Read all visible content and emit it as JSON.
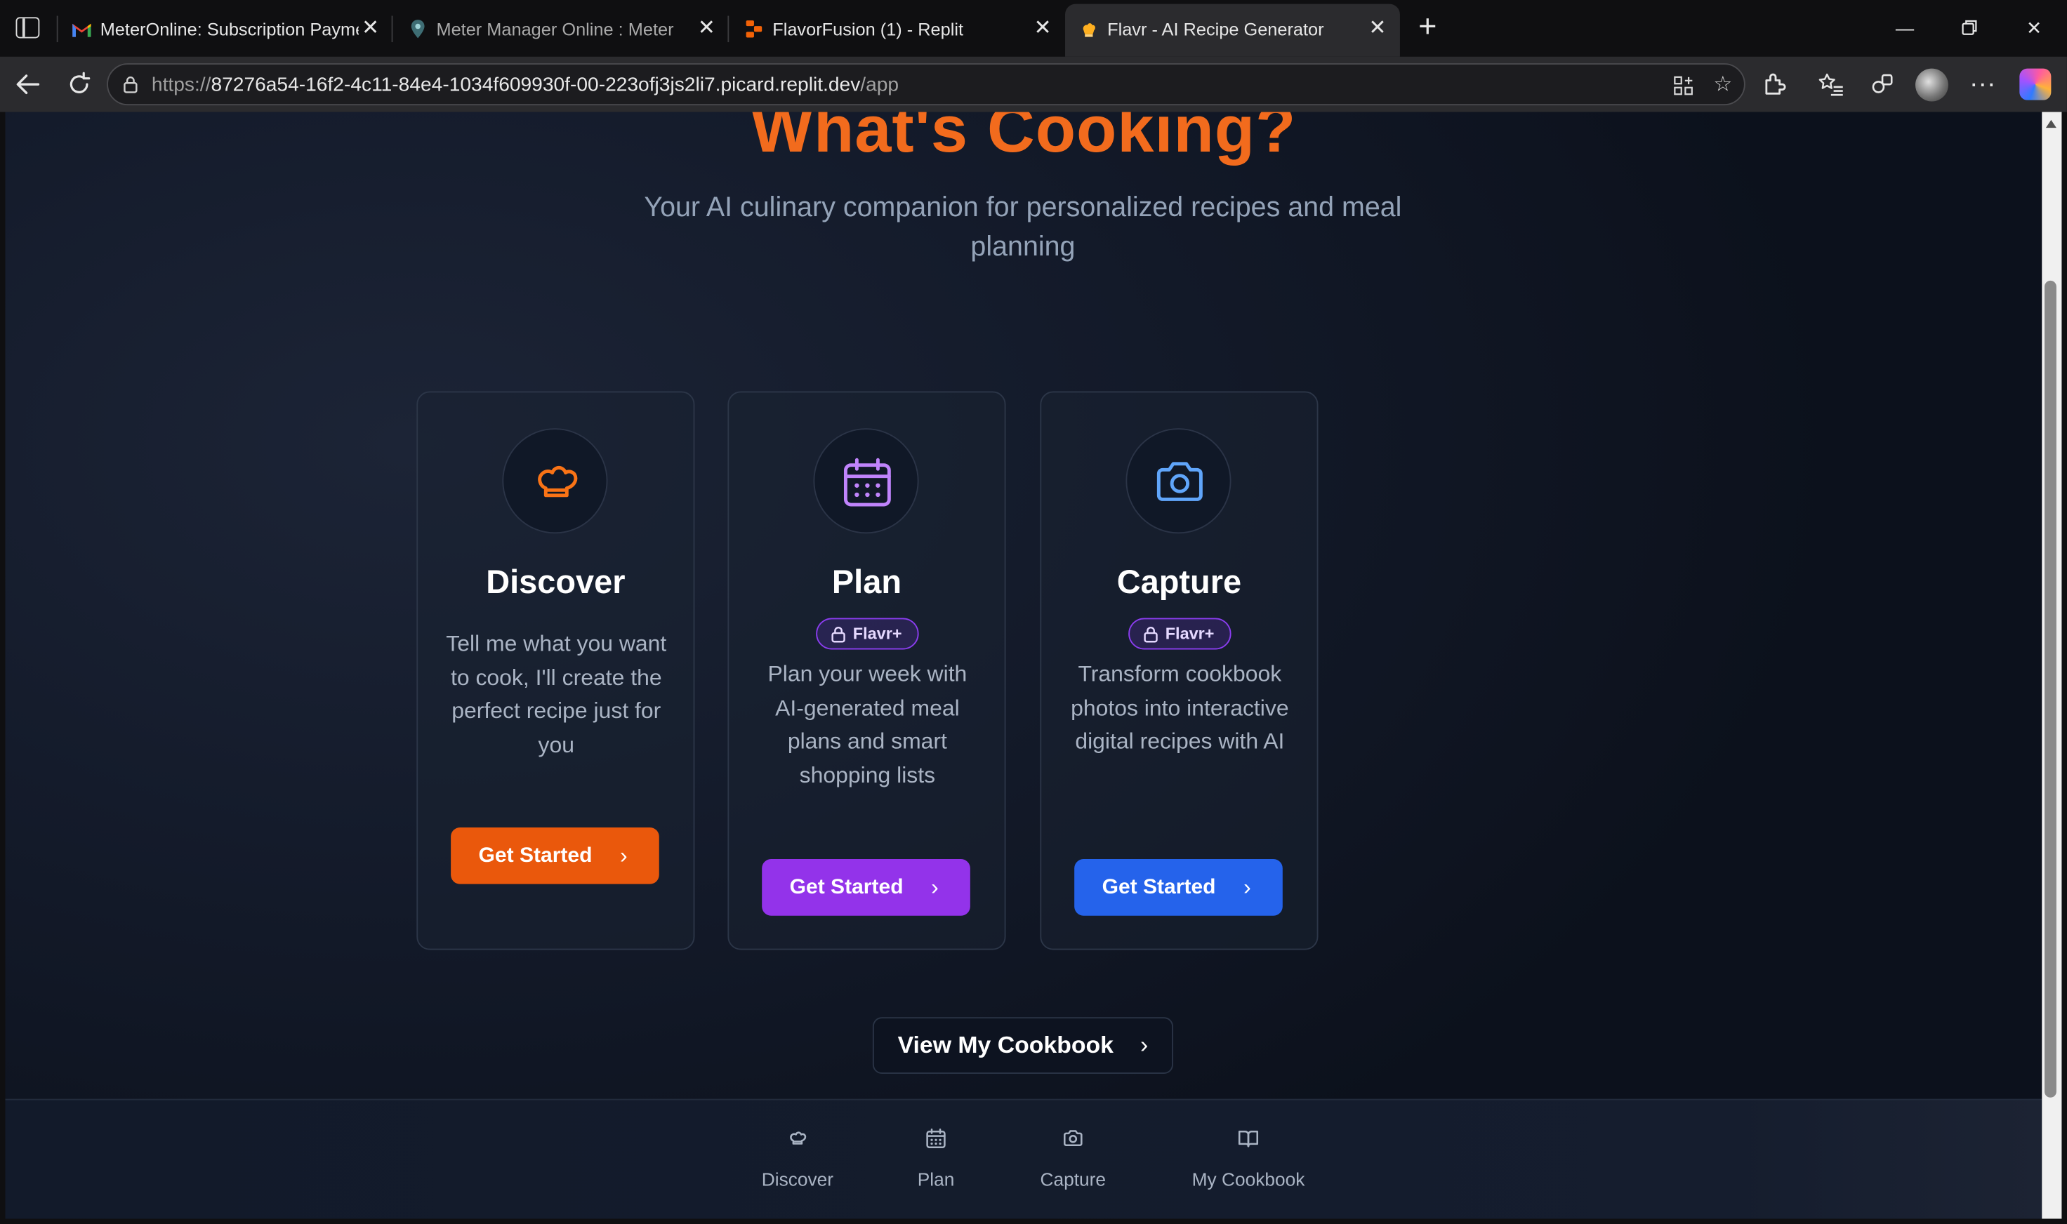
{
  "browser": {
    "tabs": [
      {
        "title": "MeterOnline: Subscription Paymen",
        "favicon": "gmail-icon",
        "active": false
      },
      {
        "title": "Meter Manager Online : Meters",
        "favicon": "location-pin-icon",
        "active": false
      },
      {
        "title": "FlavorFusion (1) - Replit",
        "favicon": "replit-icon",
        "active": false
      },
      {
        "title": "Flavr - AI Recipe Generator",
        "favicon": "flavr-icon",
        "active": true
      }
    ],
    "url": {
      "scheme": "https://",
      "host": "87276a54-16f2-4c11-84e4-1034f609930f-00-223ofj3js2li7.picard.replit.dev",
      "path": "/app"
    }
  },
  "hero": {
    "title": "What's Cooking?",
    "subtitle": "Your AI culinary companion for personalized recipes and meal planning"
  },
  "cards": [
    {
      "title": "Discover",
      "badge": "",
      "description": "Tell me what you want to cook, I'll create the perfect recipe just for you",
      "button": "Get Started",
      "icon": "chef-hat-icon",
      "accent": "#f97316",
      "button_color": "#ea580c"
    },
    {
      "title": "Plan",
      "badge": "Flavr+",
      "description": "Plan your week with AI-generated meal plans and smart shopping lists",
      "button": "Get Started",
      "icon": "calendar-icon",
      "accent": "#c084fc",
      "button_color": "#9333ea"
    },
    {
      "title": "Capture",
      "badge": "Flavr+",
      "description": "Transform cookbook photos into interactive digital recipes with AI",
      "button": "Get Started",
      "icon": "camera-icon",
      "accent": "#60a5fa",
      "button_color": "#2563eb"
    }
  ],
  "cookbook_button": "View My Cookbook",
  "bottom_nav": [
    {
      "label": "Discover",
      "icon": "chef-hat-icon"
    },
    {
      "label": "Plan",
      "icon": "calendar-icon"
    },
    {
      "label": "Capture",
      "icon": "camera-icon"
    },
    {
      "label": "My Cookbook",
      "icon": "book-icon"
    }
  ]
}
